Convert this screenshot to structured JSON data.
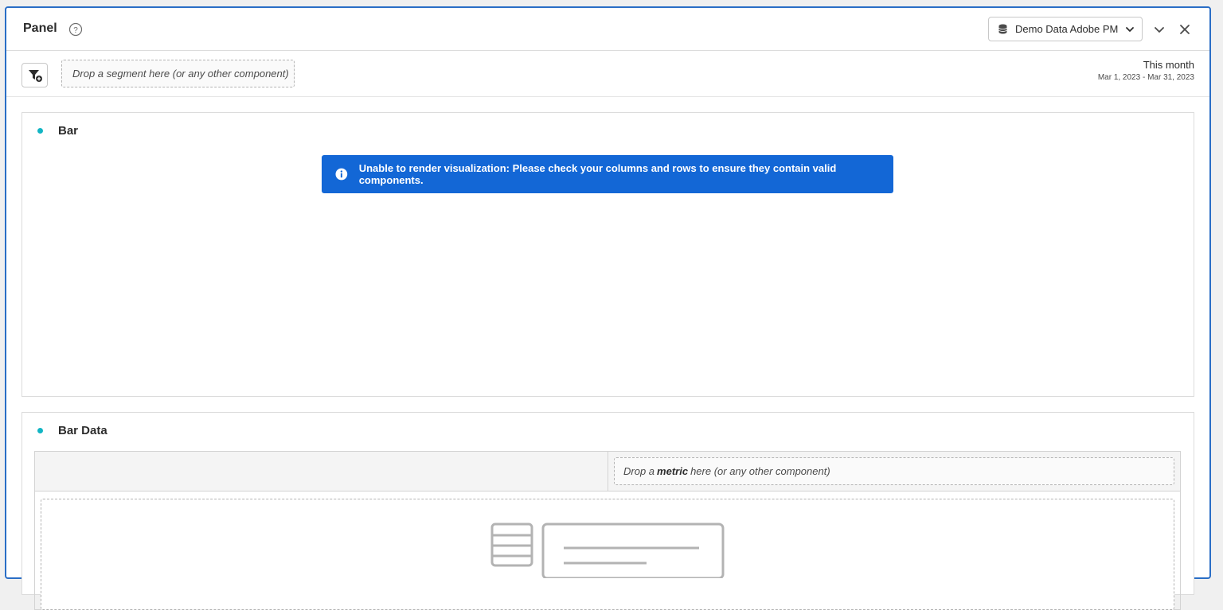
{
  "panel": {
    "title": "Panel",
    "report_suite": "Demo Data Adobe PM"
  },
  "segment_bar": {
    "drop_placeholder": "Drop a segment here (or any other component)",
    "date_period": "This month",
    "date_range": "Mar 1, 2023 - Mar 31, 2023"
  },
  "visualizations": {
    "bar": {
      "title": "Bar",
      "error_message": "Unable to render visualization: Please check your columns and rows to ensure they contain valid components."
    },
    "table": {
      "title": "Bar Data",
      "metric_drop_prefix": "Drop a",
      "metric_drop_bold": "metric",
      "metric_drop_suffix": "here (or any other component)"
    }
  },
  "colors": {
    "accent_border": "#2a6ec6",
    "info_banner": "#1367d6",
    "viz_dot": "#12b5c4"
  },
  "icons": {
    "help": "help-circle-icon",
    "database": "database-icon",
    "chevron": "chevron-down-icon",
    "close": "close-icon",
    "filter": "filter-add-icon",
    "info": "info-icon"
  }
}
